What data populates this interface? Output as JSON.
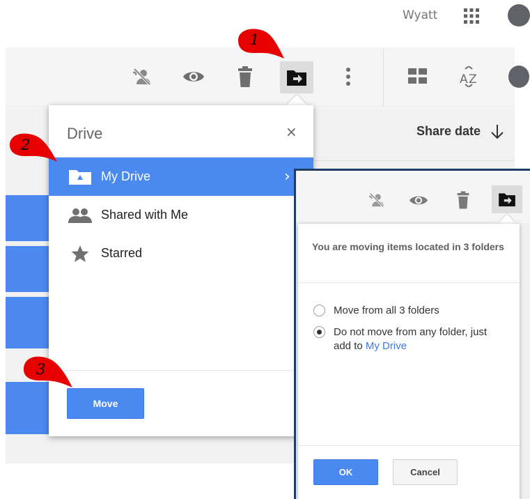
{
  "header": {
    "account_name": "Wyatt"
  },
  "toolbar": {
    "icons": [
      "remove-person-icon",
      "preview-eye-icon",
      "trash-icon",
      "move-to-folder-icon",
      "more-vert-icon",
      "grid-view-icon",
      "sort-az-icon"
    ]
  },
  "list": {
    "sort_label": "Share date",
    "sort_direction": "down"
  },
  "drive_dialog": {
    "title": "Drive",
    "close": "×",
    "items": [
      {
        "label": "My Drive",
        "icon": "drive-folder-icon",
        "selected": true
      },
      {
        "label": "Shared with Me",
        "icon": "people-icon",
        "selected": false
      },
      {
        "label": "Starred",
        "icon": "star-icon",
        "selected": false
      }
    ],
    "chevron": "›",
    "move_button": "Move"
  },
  "inset_dialog": {
    "heading": "You are moving items located in 3 folders",
    "options": [
      {
        "label": "Move from all 3 folders",
        "checked": false
      },
      {
        "label": "Do not move from any folder, just add to ",
        "link": "My Drive",
        "checked": true
      }
    ],
    "ok_button": "OK",
    "cancel_button": "Cancel"
  },
  "markers": [
    "1",
    "2",
    "3"
  ],
  "colors": {
    "accent": "#4a89f0",
    "marker_red": "#e60000",
    "inset_border": "#1f3d66"
  }
}
